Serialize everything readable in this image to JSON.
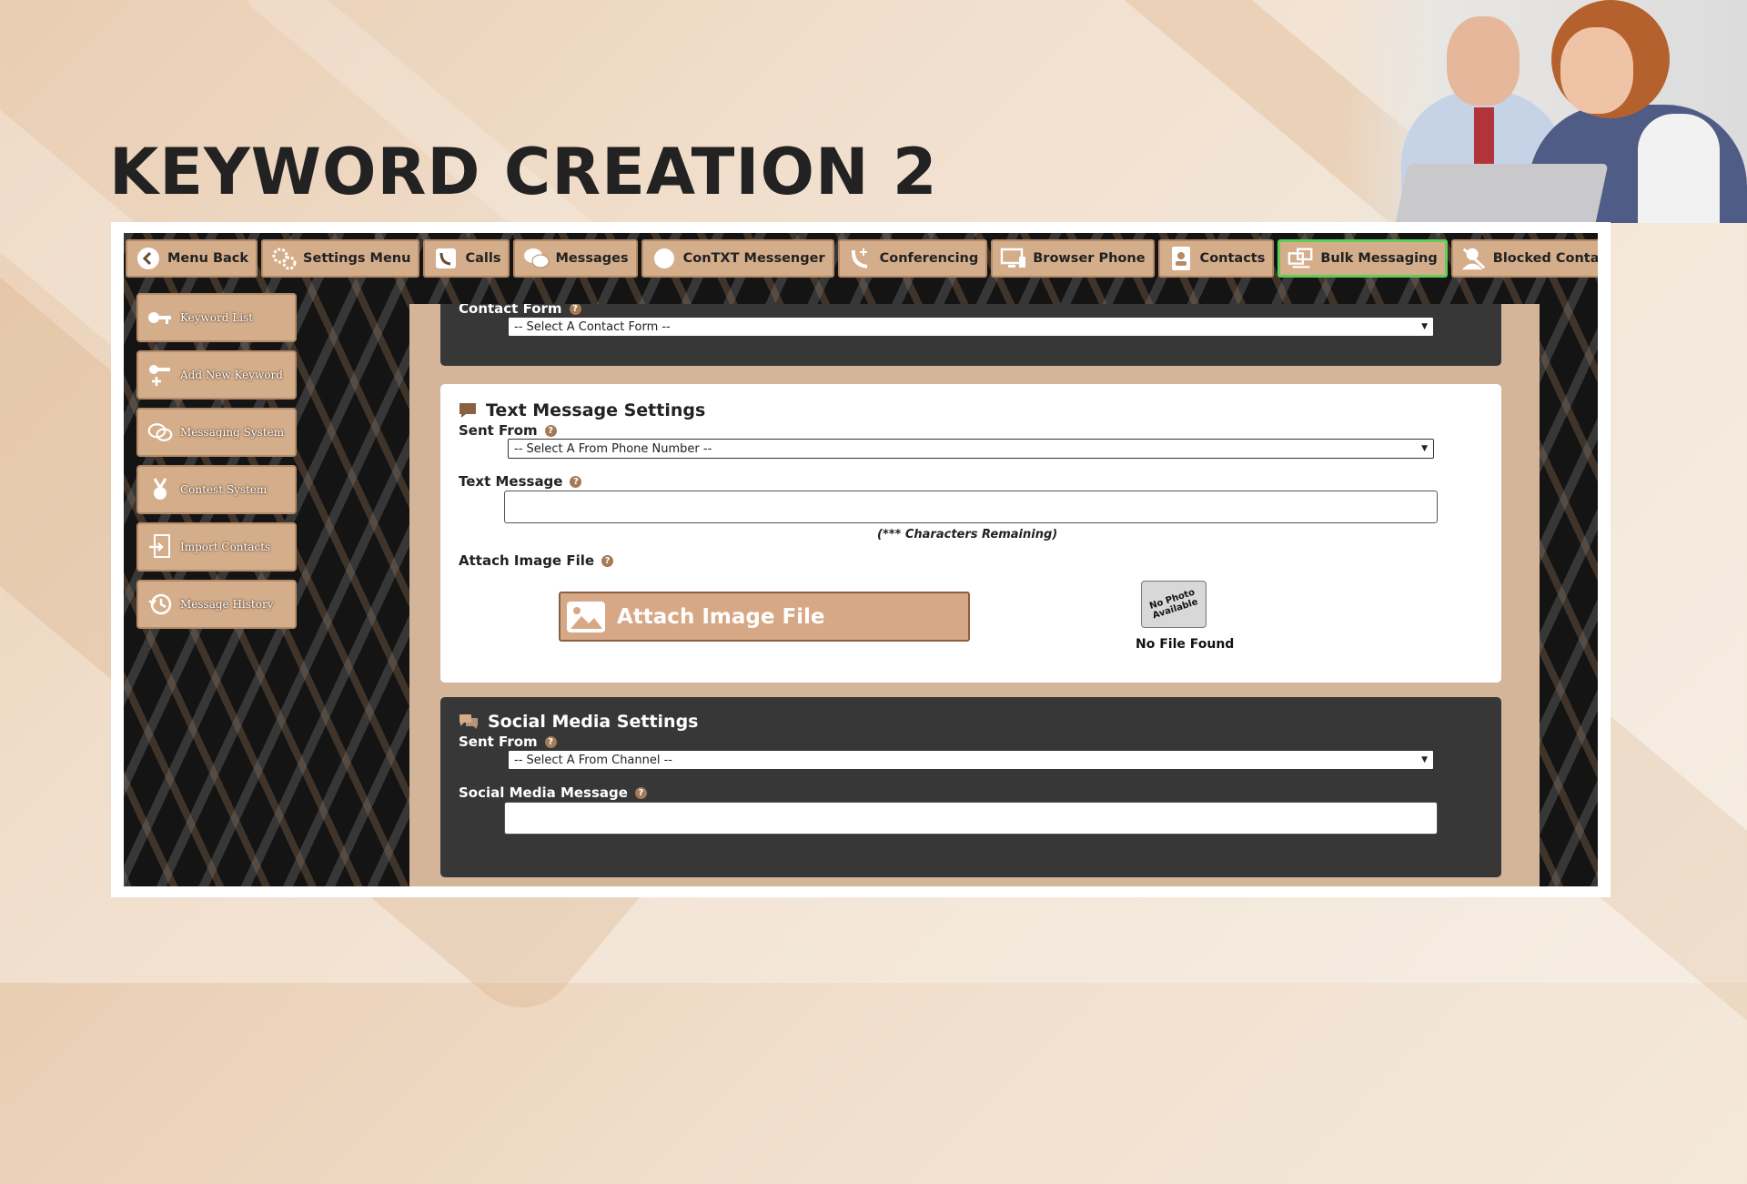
{
  "page": {
    "title": "KEYWORD CREATION 2"
  },
  "topnav": [
    {
      "label": "Menu Back",
      "icon": "back-arrow-icon"
    },
    {
      "label": "Settings Menu",
      "icon": "gears-icon"
    },
    {
      "label": "Calls",
      "icon": "phone-icon"
    },
    {
      "label": "Messages",
      "icon": "chat-bubbles-icon"
    },
    {
      "label": "ConTXT Messenger",
      "icon": "speech-bubble-icon"
    },
    {
      "label": "Conferencing",
      "icon": "conference-phone-icon"
    },
    {
      "label": "Browser Phone",
      "icon": "monitor-phone-icon"
    },
    {
      "label": "Contacts",
      "icon": "contact-card-icon"
    },
    {
      "label": "Bulk Messaging",
      "icon": "bulk-message-icon",
      "active": true
    },
    {
      "label": "Blocked Contacts",
      "icon": "blocked-user-icon"
    }
  ],
  "sidebar": [
    {
      "label": "Keyword List",
      "icon": "key-icon"
    },
    {
      "label": "Add New Keyword",
      "icon": "key-add-icon"
    },
    {
      "label": "Messaging System",
      "icon": "messaging-icon"
    },
    {
      "label": "Contest System",
      "icon": "medal-icon"
    },
    {
      "label": "Import Contacts",
      "icon": "import-icon"
    },
    {
      "label": "Message History",
      "icon": "history-icon"
    }
  ],
  "contact_form": {
    "label": "Contact Form",
    "select_value": "-- Select A Contact Form --"
  },
  "text_message_settings": {
    "title": "Text Message Settings",
    "sent_from_label": "Sent From",
    "sent_from_value": "-- Select A From Phone Number --",
    "text_message_label": "Text Message",
    "chars_remaining": "(*** Characters Remaining)",
    "attach_label": "Attach Image File",
    "attach_button": "Attach Image File",
    "no_photo": "No Photo Available",
    "no_file": "No File Found"
  },
  "social_media_settings": {
    "title": "Social Media Settings",
    "sent_from_label": "Sent From",
    "sent_from_value": "-- Select A From Channel --",
    "message_label": "Social Media Message"
  },
  "colors": {
    "button_tan": "#d4ad8b",
    "active_border": "#5fce58",
    "dark_panel": "#373737",
    "content_bg": "#d4b59a"
  }
}
